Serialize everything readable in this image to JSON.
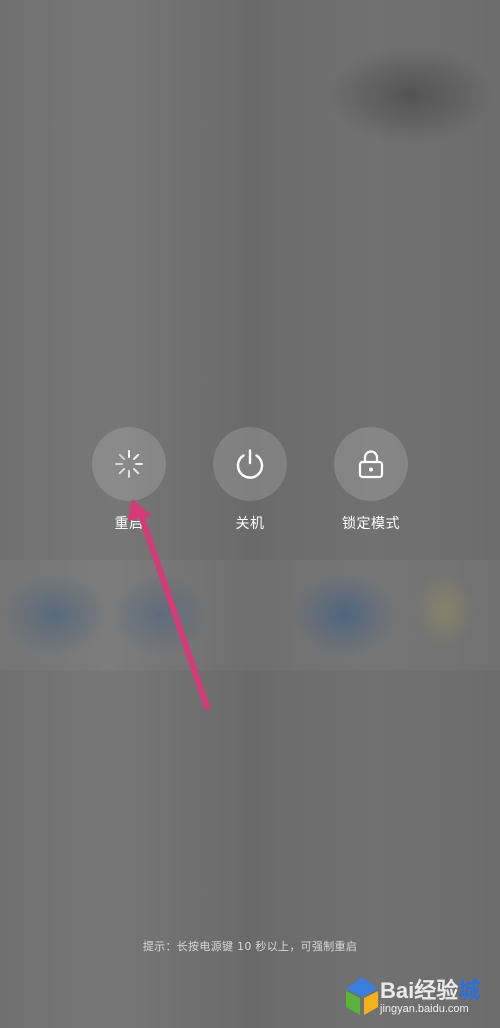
{
  "power_menu": {
    "actions": [
      {
        "id": "restart",
        "label": "重启",
        "icon": "restart-spinner-icon"
      },
      {
        "id": "power_off",
        "label": "关机",
        "icon": "power-icon"
      },
      {
        "id": "lock_mode",
        "label": "锁定模式",
        "icon": "lock-icon"
      }
    ],
    "hint": "提示：长按电源键 10 秒以上，可强制重启"
  },
  "overlay": {
    "arrow_color": "#d63a78"
  },
  "watermark": {
    "main_a": "Bai",
    "main_b": "经验",
    "accent": "城",
    "sub": "jingyan.baidu.com"
  }
}
